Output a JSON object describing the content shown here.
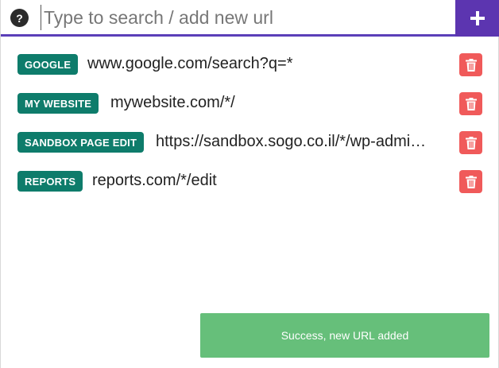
{
  "search": {
    "help_label": "?",
    "placeholder": "Type to search / add new url",
    "value": "",
    "add_label": "+"
  },
  "urls": [
    {
      "tag": "GOOGLE",
      "url": "www.google.com/search?q=*"
    },
    {
      "tag": "MY WEBSITE",
      "url": "mywebsite.com/*/"
    },
    {
      "tag": "SANDBOX PAGE EDIT",
      "url": "https://sandbox.sogo.co.il/*/wp-admin/post.php?action=edit"
    },
    {
      "tag": "REPORTS",
      "url": "reports.com/*/edit"
    }
  ],
  "toast": {
    "message": "Success, new URL added"
  },
  "colors": {
    "accent": "#5c35b0",
    "tag_bg": "#0e7c6b",
    "delete_bg": "#f05a5a",
    "toast_bg": "#66bf7a"
  },
  "icons": {
    "help": "question-icon",
    "add": "plus-icon",
    "delete": "trash-icon"
  }
}
